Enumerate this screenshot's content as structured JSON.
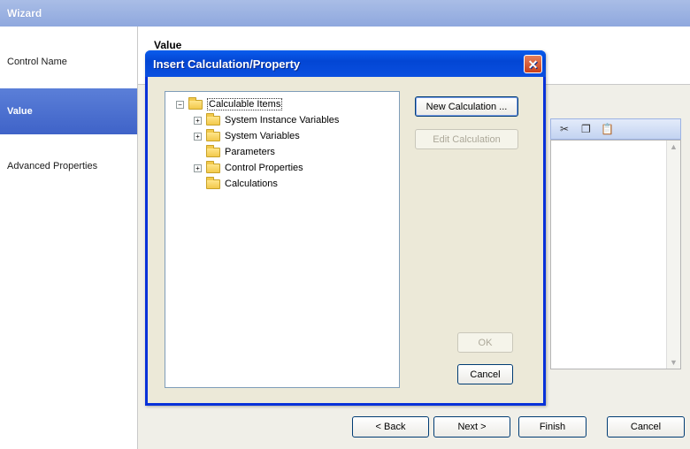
{
  "wizard": {
    "title": "Wizard",
    "nav_items": [
      {
        "label": "Control Name"
      },
      {
        "label": "Value"
      },
      {
        "label": "Advanced Properties"
      }
    ],
    "header_title": "Value",
    "footer": {
      "back": "< Back",
      "next": "Next >",
      "finish": "Finish",
      "cancel": "Cancel"
    },
    "editor_toolbar_icons": [
      "cut-icon",
      "copy-icon",
      "paste-icon"
    ]
  },
  "dialog": {
    "title": "Insert Calculation/Property",
    "close_glyph": "✕",
    "tree": {
      "root": "Calculable Items",
      "children": [
        {
          "label": "System Instance Variables",
          "expandable": true
        },
        {
          "label": "System Variables",
          "expandable": true
        },
        {
          "label": "Parameters",
          "expandable": false
        },
        {
          "label": "Control Properties",
          "expandable": true
        },
        {
          "label": "Calculations",
          "expandable": false
        }
      ]
    },
    "buttons": {
      "new_calculation": "New Calculation ...",
      "edit_calculation": "Edit Calculation",
      "ok": "OK",
      "cancel": "Cancel"
    }
  }
}
